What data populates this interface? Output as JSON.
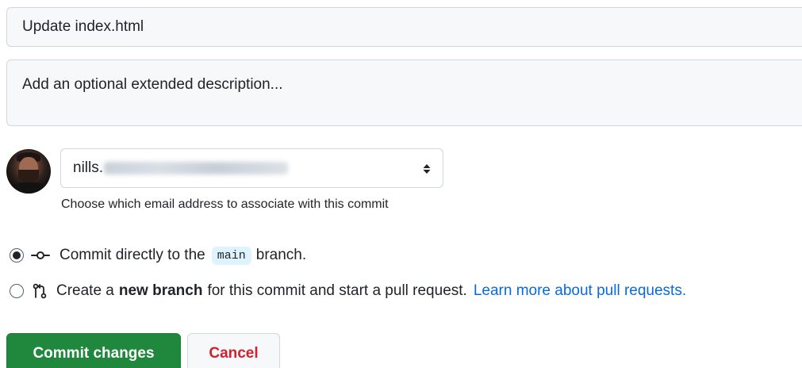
{
  "commit_form": {
    "summary_value": "Update index.html",
    "description_placeholder": "Add an optional extended description...",
    "author": {
      "email_visible_prefix": "nills.",
      "email_hint": "Choose which email address to associate with this commit"
    },
    "options": [
      {
        "selected": true,
        "icon": "git-commit-icon",
        "text_before": "Commit directly to the",
        "branch": "main",
        "text_after": "branch."
      },
      {
        "selected": false,
        "icon": "git-pull-request-icon",
        "text_before": "Create a",
        "bold_text": "new branch",
        "text_after": "for this commit and start a pull request.",
        "link_text": "Learn more about pull requests."
      }
    ],
    "buttons": {
      "commit_label": "Commit changes",
      "cancel_label": "Cancel"
    }
  },
  "colors": {
    "primary_button": "#1f883d",
    "danger_text": "#cf222e",
    "link": "#0969da",
    "branch_pill_bg": "#ddf4ff"
  }
}
